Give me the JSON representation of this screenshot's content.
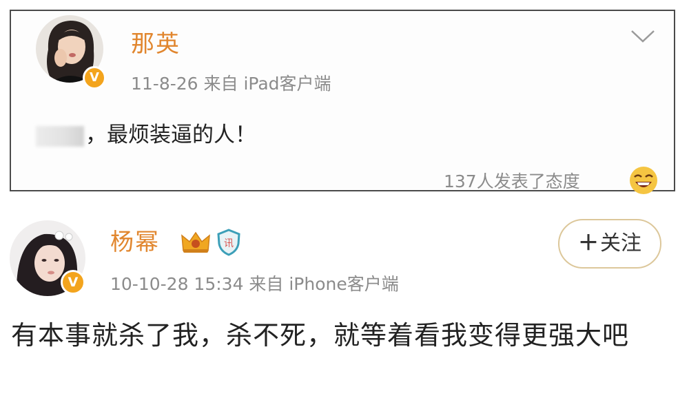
{
  "post1": {
    "user_name": "那英",
    "meta": "11-8-26  来自 iPad客户端",
    "content": "，最烦装逼的人！",
    "reactions": "137人发表了态度",
    "icons": {
      "verified": "verified-v-badge",
      "menu": "chevron-down-icon",
      "reaction": "laughing-emoji-icon"
    }
  },
  "post2": {
    "user_name": "杨幂",
    "meta": "10-10-28 15:34  来自 iPhone客户端",
    "follow_label": "关注",
    "content": "有本事就杀了我，杀不死，就等着看我变得更强大吧",
    "icons": {
      "verified": "verified-v-badge",
      "crown": "crown-badge-icon",
      "shield": "shield-badge-icon"
    }
  },
  "colors": {
    "name": "#e1862e",
    "meta": "#8b8b8b",
    "badge": "#f3a41d",
    "follow_border": "#dcc79a",
    "border": "#4a4a4a"
  }
}
